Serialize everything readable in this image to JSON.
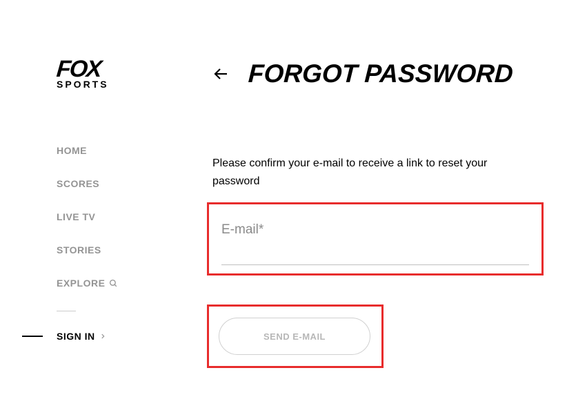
{
  "logo": {
    "top": "FOX",
    "bottom": "SPORTS"
  },
  "nav": {
    "items": [
      {
        "label": "HOME"
      },
      {
        "label": "SCORES"
      },
      {
        "label": "LIVE TV"
      },
      {
        "label": "STORIES"
      },
      {
        "label": "EXPLORE"
      }
    ],
    "signIn": "SIGN IN"
  },
  "main": {
    "title": "FORGOT PASSWORD",
    "instruction": "Please confirm your e-mail to receive a link to reset your password",
    "emailLabel": "E-mail*",
    "emailValue": "",
    "sendButton": "SEND E-MAIL"
  }
}
